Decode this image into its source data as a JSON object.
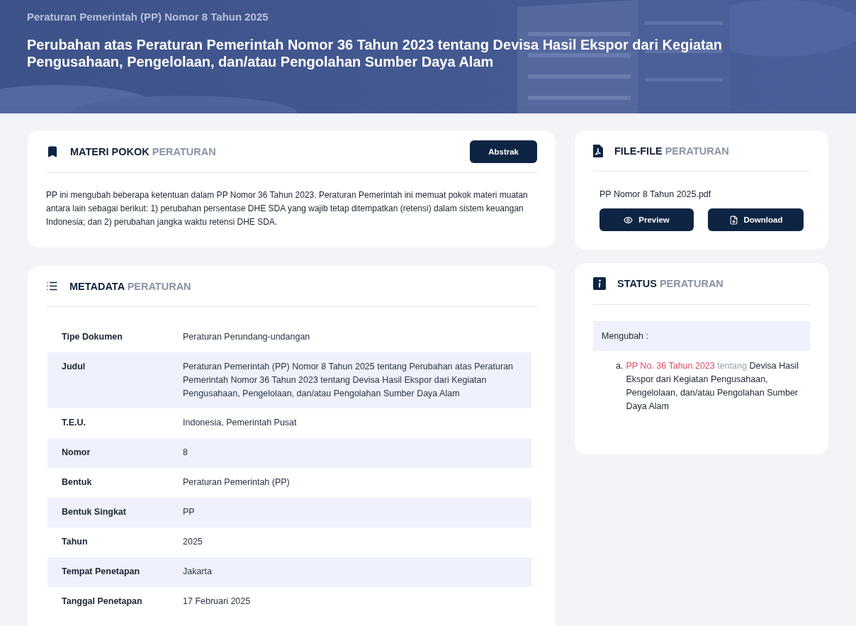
{
  "header": {
    "kind": "picture",
    "overline": "Peraturan Pemerintah (PP) Nomor 8 Tahun 2025",
    "title": "Perubahan atas Peraturan Pemerintah Nomor 36 Tahun 2023 tentang Devisa Hasil Ekspor dari Kegiatan Pengusahaan, Pengelolaan, dan/atau Pengolahan Sumber Daya Alam"
  },
  "materi": {
    "title": {
      "main": "MATERI POKOK",
      "sub": "PERATURAN"
    },
    "button": "Abstrak",
    "text": "PP ini mengubah beberapa ketentuan dalam PP Nomor 36 Tahun 2023. Peraturan Pemerintah ini memuat pokok materi muatan antara lain sebagai berikut: 1) perubahan persentase DHE SDA yang wajib tetap ditempatkan (retensi) dalam sistem keuangan Indonesia; dan 2) perubahan jangka waktu retensi DHE SDA."
  },
  "metadata": {
    "title": {
      "main": "METADATA",
      "sub": "PERATURAN"
    },
    "rows": [
      {
        "label": "Tipe Dokumen",
        "value": "Peraturan Perundang-undangan"
      },
      {
        "label": "Judul",
        "value": "Peraturan Pemerintah (PP) Nomor 8 Tahun 2025 tentang Perubahan atas Peraturan Pemerintah Nomor 36 Tahun 2023 tentang Devisa Hasil Ekspor dari Kegiatan Pengusahaan, Pengelolaan, dan/atau Pengolahan Sumber Daya Alam"
      },
      {
        "label": "T.E.U.",
        "value": "Indonesia, Pemerintah Pusat"
      },
      {
        "label": "Nomor",
        "value": "8"
      },
      {
        "label": "Bentuk",
        "value": "Peraturan Pemerintah (PP)"
      },
      {
        "label": "Bentuk Singkat",
        "value": "PP"
      },
      {
        "label": "Tahun",
        "value": "2025"
      },
      {
        "label": "Tempat Penetapan",
        "value": "Jakarta"
      },
      {
        "label": "Tanggal Penetapan",
        "value": "17 Februari 2025"
      }
    ]
  },
  "files": {
    "title": {
      "main": "FILE-FILE",
      "sub": "PERATURAN"
    },
    "filename": "PP Nomor 8 Tahun 2025.pdf",
    "buttons": [
      {
        "kind": "preview",
        "label": "Preview"
      },
      {
        "kind": "download",
        "label": "Download"
      }
    ]
  },
  "status": {
    "title": {
      "main": "STATUS",
      "sub": "PERATURAN"
    },
    "group": "Mengubah :",
    "items": [
      {
        "marker": "a.",
        "link": "PP No. 36 Tahun 2023",
        "joiner": "tentang",
        "subject": "Devisa Hasil Ekspor dari Kegiatan Pengusahaan, Pengelolaan, dan/atau Pengolahan Sumber Daya Alam"
      }
    ]
  }
}
